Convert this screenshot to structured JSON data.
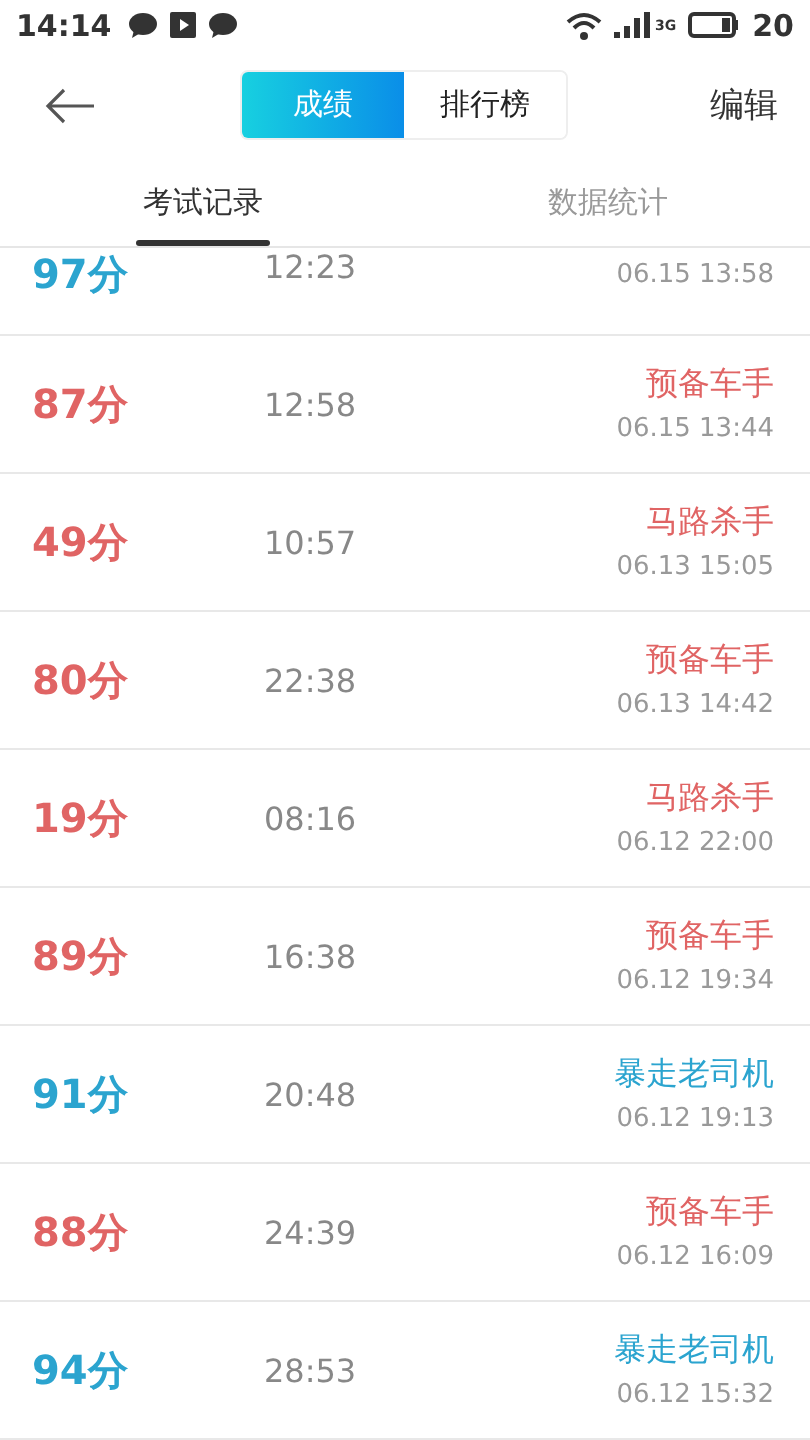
{
  "status_bar": {
    "time": "14:14",
    "network": "3G",
    "battery": "20"
  },
  "toolbar": {
    "segments": [
      {
        "label": "成绩",
        "selected": true
      },
      {
        "label": "排行榜",
        "selected": false
      }
    ],
    "action": "编辑"
  },
  "tabs": [
    {
      "label": "考试记录",
      "selected": true
    },
    {
      "label": "数据统计",
      "selected": false
    }
  ],
  "records": [
    {
      "score": "97分",
      "duration": "12:23",
      "date": "06.15  13:58",
      "color": "#2ba4cf"
    },
    {
      "score": "87分",
      "duration": "12:58",
      "title": "预备车手",
      "date": "06.15  13:44",
      "color": "#e06464"
    },
    {
      "score": "49分",
      "duration": "10:57",
      "title": "马路杀手",
      "date": "06.13  15:05",
      "color": "#e06464"
    },
    {
      "score": "80分",
      "duration": "22:38",
      "title": "预备车手",
      "date": "06.13  14:42",
      "color": "#e06464"
    },
    {
      "score": "19分",
      "duration": "08:16",
      "title": "马路杀手",
      "date": "06.12  22:00",
      "color": "#e06464"
    },
    {
      "score": "89分",
      "duration": "16:38",
      "title": "预备车手",
      "date": "06.12  19:34",
      "color": "#e06464"
    },
    {
      "score": "91分",
      "duration": "20:48",
      "title": "暴走老司机",
      "date": "06.12  19:13",
      "color": "#2ba4cf"
    },
    {
      "score": "88分",
      "duration": "24:39",
      "title": "预备车手",
      "date": "06.12  16:09",
      "color": "#e06464"
    },
    {
      "score": "94分",
      "duration": "28:53",
      "title": "暴走老司机",
      "date": "06.12  15:32",
      "color": "#2ba4cf"
    }
  ]
}
